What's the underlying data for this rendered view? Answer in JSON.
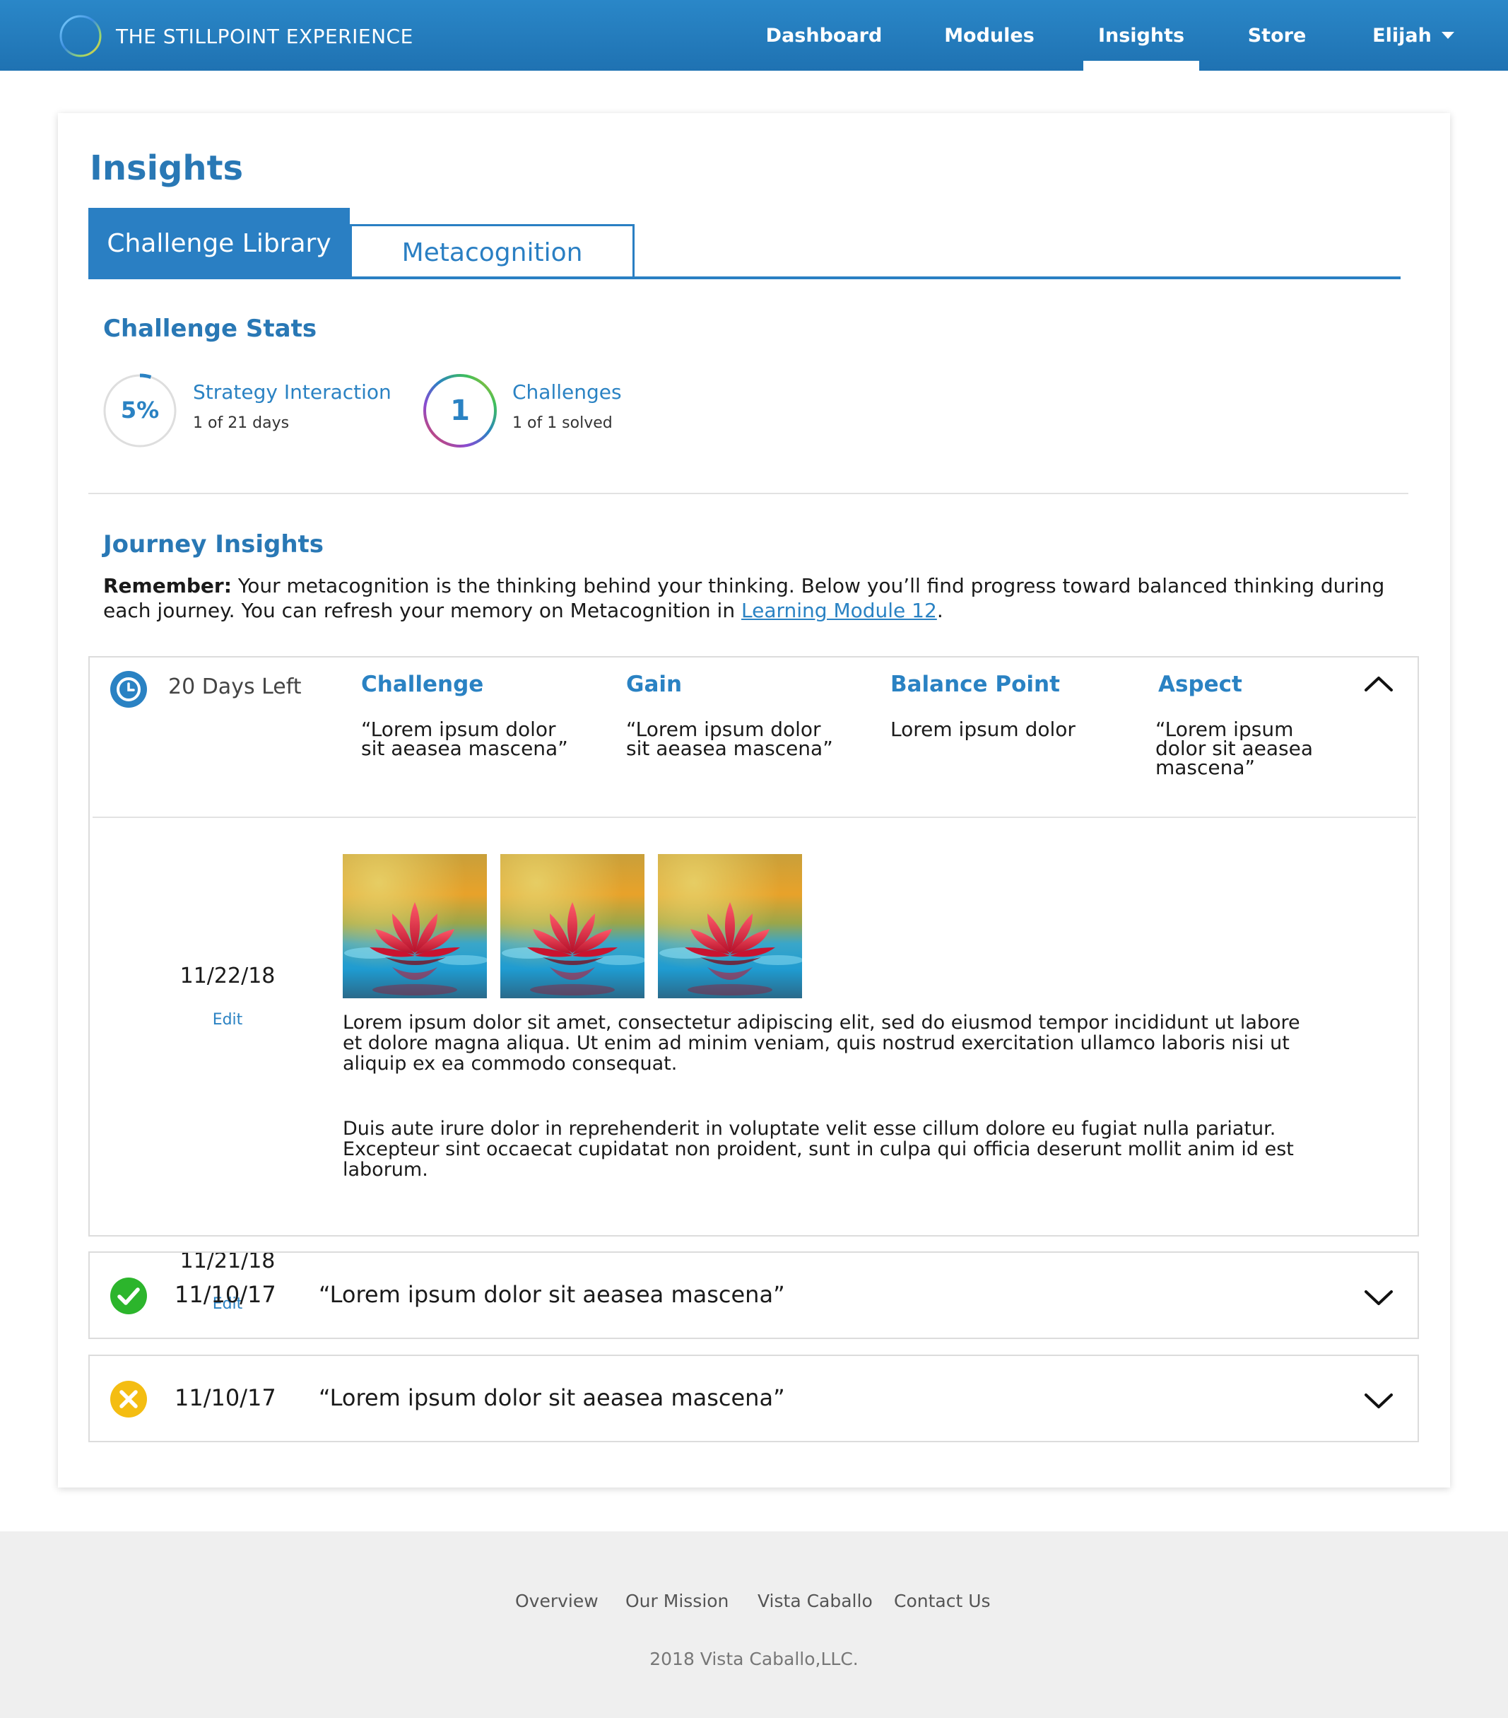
{
  "app": {
    "brand_name": "THE STILLPOINT EXPERIENCE",
    "logo_icon": "ring-logo-icon",
    "accent_color": "#2a7fc3"
  },
  "nav": {
    "items": [
      {
        "label": "Dashboard",
        "active": false
      },
      {
        "label": "Modules",
        "active": false
      },
      {
        "label": "Insights",
        "active": true
      },
      {
        "label": "Store",
        "active": false
      }
    ],
    "user": {
      "label": "Elijah",
      "icon": "caret-down-icon"
    }
  },
  "page": {
    "title": "Insights",
    "tabs": [
      {
        "label": "Challenge Library",
        "active": true
      },
      {
        "label": "Metacognition",
        "active": false
      }
    ]
  },
  "challenge_stats": {
    "title": "Challenge Stats",
    "items": [
      {
        "value": "5%",
        "progress": 0.05,
        "label": "Strategy Interaction",
        "sub": "1 of 21 days"
      },
      {
        "value": "1",
        "progress": 1.0,
        "label": "Challenges",
        "sub": "1 of 1 solved"
      }
    ]
  },
  "journey": {
    "title": "Journey Insights",
    "remember_label": "Remember:",
    "remember_text": "Your metacognition is the thinking behind your thinking. Below you’ll find progress toward balanced thinking  during each journey. You can refresh your memory on Metacognition in ",
    "remember_link": "Learning Module 12",
    "remember_end": ".",
    "current": {
      "days_left": "20 Days Left",
      "columns": [
        {
          "head": "Challenge",
          "value": "“Lorem ipsum dolor sit aeasea mascena”"
        },
        {
          "head": "Gain",
          "value": "“Lorem ipsum dolor sit aeasea mascena”"
        },
        {
          "head": "Balance Point",
          "value": "Lorem ipsum dolor"
        },
        {
          "head": "Aspect",
          "value": "“Lorem ipsum dolor sit aeasea mascena”"
        }
      ],
      "entries": [
        {
          "date": "11/22/18",
          "edit": "Edit",
          "text": "Lorem ipsum dolor sit amet, consectetur adipiscing elit, sed do eiusmod tempor incididunt ut labore et dolore magna aliqua. Ut enim ad minim veniam, quis nostrud exercitation ullamco laboris nisi ut aliquip ex ea commodo consequat."
        },
        {
          "date": "11/21/18",
          "edit": "Edit",
          "text": "Duis aute irure dolor in reprehenderit in voluptate velit esse cillum dolore eu fugiat nulla pariatur. Excepteur sint occaecat cupidatat non proident, sunt in culpa qui officia deserunt mollit anim id est laborum."
        }
      ]
    },
    "past": [
      {
        "status": "complete",
        "icon": "check-circle-icon",
        "color": "#2cb52c",
        "date": "11/10/17",
        "quote": "“Lorem ipsum dolor sit aeasea mascena”"
      },
      {
        "status": "failed",
        "icon": "x-circle-icon",
        "color": "#f4bd12",
        "date": "11/10/17",
        "quote": "“Lorem ipsum dolor sit aeasea mascena”"
      }
    ]
  },
  "footer": {
    "links": [
      "Overview",
      "Our Mission",
      "Vista Caballo",
      "Contact Us"
    ],
    "copyright": "2018 Vista Caballo,LLC."
  }
}
